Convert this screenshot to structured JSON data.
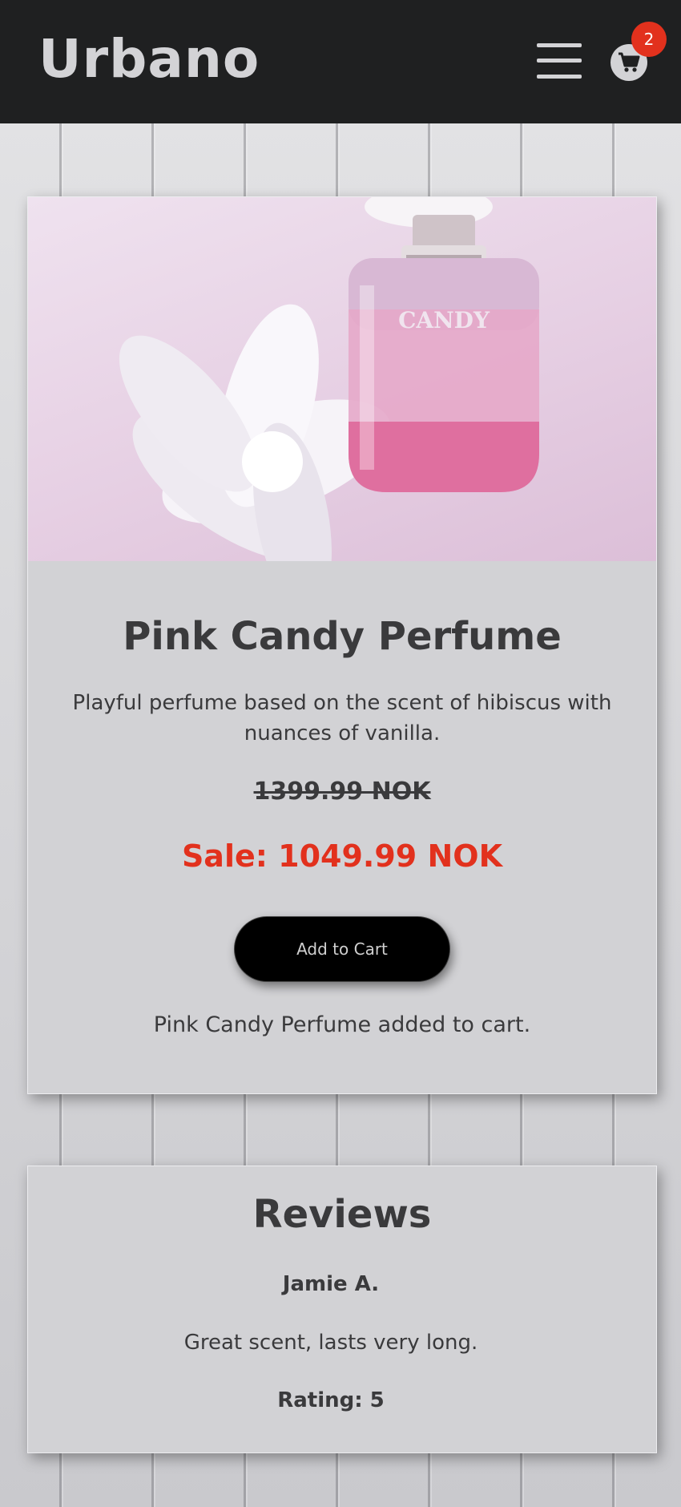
{
  "header": {
    "logo": "Urbano",
    "cart_count": "2",
    "menu_icon": "hamburger-menu-icon",
    "cart_icon": "shopping-cart-icon"
  },
  "product": {
    "image_label": "CANDY",
    "title": "Pink Candy Perfume",
    "description": "Playful perfume based on the scent of hibiscus with nuances of vanilla.",
    "original_price": "1399.99 NOK",
    "sale_price": "Sale: 1049.99 NOK",
    "add_button_label": "Add to Cart",
    "added_message": "Pink Candy Perfume added to cart."
  },
  "reviews": {
    "title": "Reviews",
    "items": [
      {
        "author": "Jamie A.",
        "text": "Great scent, lasts very long.",
        "rating": "Rating: 5"
      }
    ]
  },
  "colors": {
    "header_bg": "#1f2021",
    "card_bg": "#d2d2d5",
    "sale_red": "#e2311d",
    "button_bg": "#000000"
  }
}
